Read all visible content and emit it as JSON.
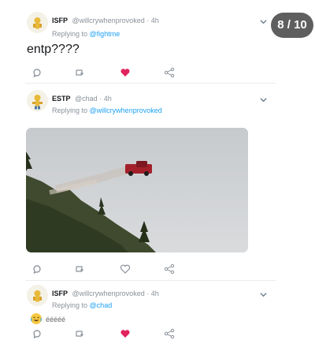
{
  "pager": {
    "label": "8 / 10"
  },
  "tweets": [
    {
      "author": "ISFP",
      "handle": "@willcrywhenprovoked",
      "time": "· 4h",
      "replying_prefix": "Replying to",
      "replying_to": "@fightme",
      "text": "entp????"
    },
    {
      "author": "ESTP",
      "handle": "@chad",
      "time": "· 4h",
      "replying_prefix": "Replying to",
      "replying_to": "@willcrywhenprovoked",
      "media": "photo of a red pickup truck flying off a forested cliff with dust trail"
    },
    {
      "author": "ISFP",
      "handle": "@willcrywhenprovoked",
      "time": "· 4h",
      "replying_prefix": "Replying to",
      "replying_to": "@chad",
      "text": "ééééé"
    }
  ],
  "icons": {
    "reply": "reply-icon",
    "retweet": "retweet-icon",
    "like": "heart-icon",
    "share": "share-icon",
    "menu": "chevron-down-icon"
  },
  "colors": {
    "link": "#1da1f2",
    "like": "#e0245e",
    "badge": "#5f5f5f"
  }
}
